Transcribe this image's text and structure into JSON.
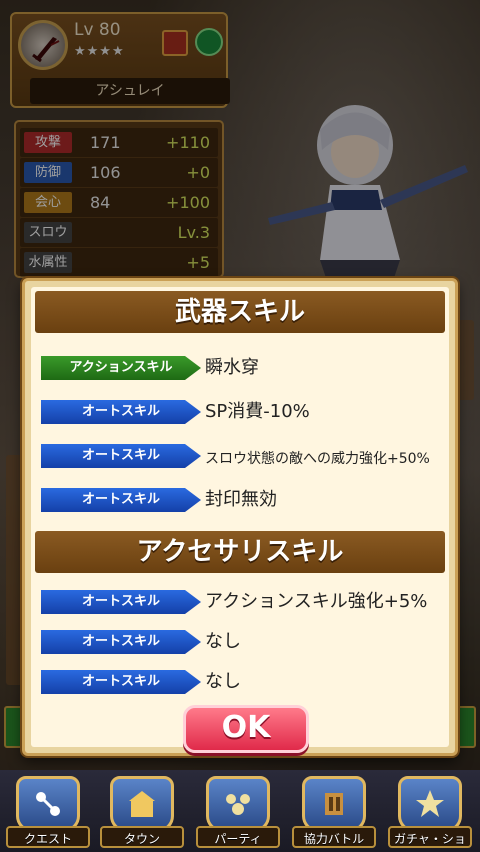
{
  "character": {
    "level": "Lv 80",
    "stars": "★★★★",
    "name": "アシュレイ"
  },
  "stats": [
    {
      "label": "攻撃",
      "value": "171",
      "bonus": "+110",
      "color": "#b02a2a"
    },
    {
      "label": "防御",
      "value": "106",
      "bonus": "+0",
      "color": "#2a5ab0"
    },
    {
      "label": "会心",
      "value": "84",
      "bonus": "+100",
      "color": "#b07a1a"
    },
    {
      "label": "スロウ",
      "value": "",
      "bonus": "Lv.3",
      "color": "#444444"
    },
    {
      "label": "水属性",
      "value": "",
      "bonus": "+5",
      "color": "#444444"
    }
  ],
  "modal": {
    "weapon_title": "武器スキル",
    "accessory_title": "アクセサリスキル",
    "weapon_skills": [
      {
        "tag": "アクションスキル",
        "type": "action",
        "text": "瞬水穿"
      },
      {
        "tag": "オートスキル",
        "type": "auto",
        "text": "SP消費-10%"
      },
      {
        "tag": "オートスキル",
        "type": "auto",
        "text": "スロウ状態の敵への威力強化+50%"
      },
      {
        "tag": "オートスキル",
        "type": "auto",
        "text": "封印無効"
      }
    ],
    "accessory_skills": [
      {
        "tag": "オートスキル",
        "type": "auto",
        "text": "アクションスキル強化+5%"
      },
      {
        "tag": "オートスキル",
        "type": "auto",
        "text": "なし"
      },
      {
        "tag": "オートスキル",
        "type": "auto",
        "text": "なし"
      }
    ],
    "ok_label": "OK"
  },
  "nav": [
    {
      "label": "クエスト",
      "icon": "quest-icon"
    },
    {
      "label": "タウン",
      "icon": "town-icon"
    },
    {
      "label": "パーティ",
      "icon": "party-icon"
    },
    {
      "label": "協力バトル",
      "icon": "coop-battle-icon"
    },
    {
      "label": "ガチャ・ショップ",
      "icon": "gacha-shop-icon"
    }
  ],
  "colors": {
    "accent_gold": "#caa056",
    "action_tag": "#2e8a20",
    "auto_tag": "#1e58d0",
    "ok_button": "#e8385a"
  }
}
